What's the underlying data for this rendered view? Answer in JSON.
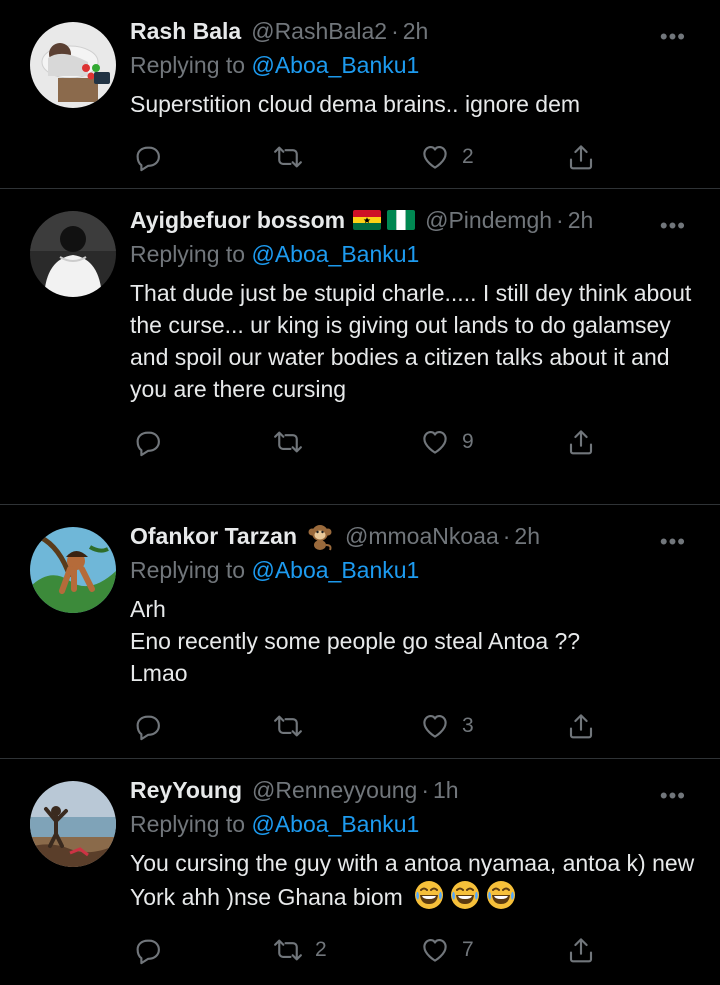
{
  "tweets": [
    {
      "name": "Rash Bala",
      "handle": "@RashBala2",
      "time": "2h",
      "reply_prefix": "Replying to",
      "reply_to": "@Aboa_Banku1",
      "text": "Superstition cloud dema brains.. ignore dem",
      "counts": {
        "replies": "",
        "retweets": "",
        "likes": "2"
      },
      "avatar_icon": "person-sleeping-avatar"
    },
    {
      "name": "Ayigbefuor bossom",
      "handle": "@Pindemgh",
      "time": "2h",
      "reply_prefix": "Replying to",
      "reply_to": "@Aboa_Banku1",
      "text": "That dude just be stupid charle..... I still dey think about the curse... ur king is giving out lands to do galamsey and spoil our water bodies a citizen talks about it and you are there cursing",
      "counts": {
        "replies": "",
        "retweets": "",
        "likes": "9"
      },
      "flags": [
        "ghana-flag",
        "nigeria-flag"
      ],
      "avatar_icon": "person-back-avatar"
    },
    {
      "name": "Ofankor Tarzan",
      "handle": "@mmoaNkoaa",
      "time": "2h",
      "reply_prefix": "Replying to",
      "reply_to": "@Aboa_Banku1",
      "text": "Arh\nEno recently some people go steal Antoa ??\nLmao",
      "counts": {
        "replies": "",
        "retweets": "",
        "likes": "3"
      },
      "emoji": "monkey-emoji",
      "avatar_icon": "tarzan-cartoon-avatar"
    },
    {
      "name": "ReyYoung",
      "handle": "@Renneyyoung",
      "time": "1h",
      "reply_prefix": "Replying to",
      "reply_to": "@Aboa_Banku1",
      "text": "You cursing the guy with a antoa nyamaa, antoa k) new York ahh )nse Ghana biom",
      "emoji_trailing": [
        "laughing-emoji",
        "laughing-emoji",
        "laughing-emoji"
      ],
      "counts": {
        "replies": "",
        "retweets": "2",
        "likes": "7"
      },
      "avatar_icon": "beach-photo-avatar"
    }
  ],
  "colors": {
    "background": "#000000",
    "text": "#e7e9ea",
    "muted": "#71767b",
    "link": "#1d9bf0",
    "divider": "#2f3336"
  }
}
